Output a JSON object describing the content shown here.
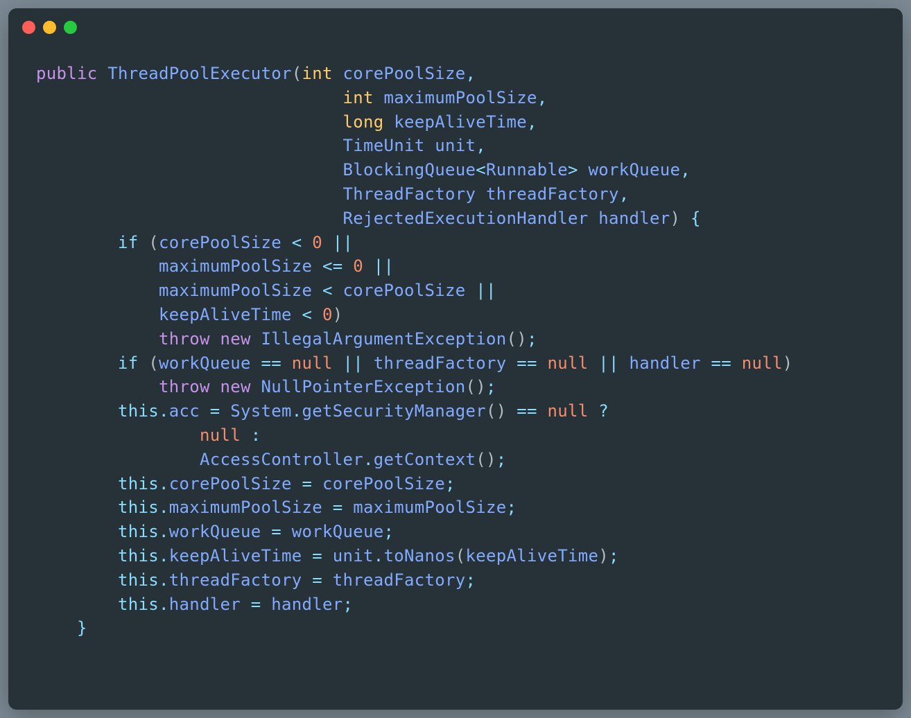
{
  "window": {
    "traffic_lights": [
      "close",
      "minimize",
      "maximize"
    ]
  },
  "code": {
    "tokens": {
      "public": "public",
      "ThreadPoolExecutor": "ThreadPoolExecutor",
      "int": "int",
      "long": "long",
      "corePoolSize": "corePoolSize",
      "maximumPoolSize": "maximumPoolSize",
      "keepAliveTime": "keepAliveTime",
      "TimeUnit": "TimeUnit",
      "unit": "unit",
      "BlockingQueue": "BlockingQueue",
      "Runnable": "Runnable",
      "workQueue": "workQueue",
      "ThreadFactory": "ThreadFactory",
      "threadFactory": "threadFactory",
      "RejectedExecutionHandler": "RejectedExecutionHandler",
      "handler": "handler",
      "if": "if",
      "zero": "0",
      "throw": "throw",
      "new": "new",
      "IllegalArgumentException": "IllegalArgumentException",
      "null": "null",
      "NullPointerException": "NullPointerException",
      "this": "this",
      "acc": "acc",
      "System": "System",
      "getSecurityManager": "getSecurityManager",
      "AccessController": "AccessController",
      "getContext": "getContext",
      "toNanos": "toNanos"
    }
  }
}
